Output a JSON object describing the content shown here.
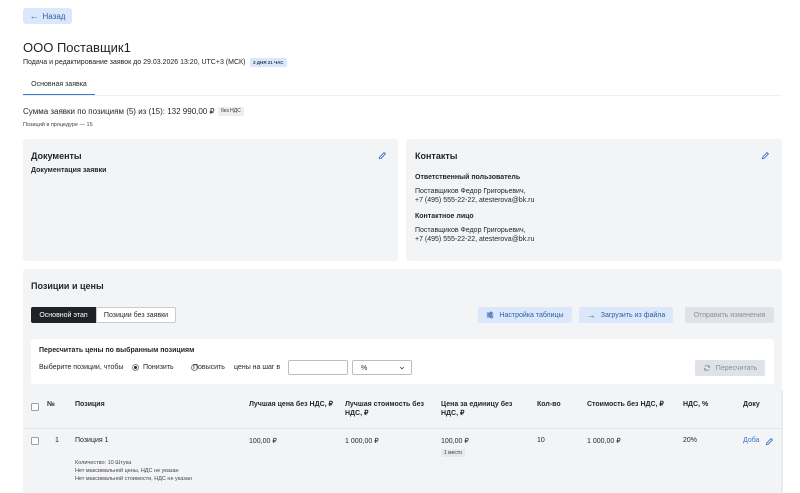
{
  "header": {
    "back_label": "Назад",
    "title": "ООО Поставщик1",
    "subtitle": "Подача и редактирование заявок до 29.03.2026 13:20, UTC+3 (МСК)",
    "deadline_badge": "3 ДНЯ 21 ЧАС"
  },
  "tabs": [
    {
      "label": "Основная заявка",
      "active": true
    }
  ],
  "summary": {
    "sum_text": "Сумма заявки по позициям (5) из (15): 132 990,00 ₽",
    "vat_badge": "без НДС",
    "positions_in_procedure": "Позиций в процедуре — 15"
  },
  "documents": {
    "title": "Документы",
    "subtitle": "Документация заявки"
  },
  "contacts": {
    "title": "Контакты",
    "responsible_label": "Ответственный пользователь",
    "responsible_name": "Поставщиков Федор Григорьевич,",
    "responsible_contact": "+7 (495) 555-22-22, atesterova@bk.ru",
    "contact_label": "Контактное лицо",
    "contact_name": "Поставщиков Федор Григорьевич,",
    "contact_contact": "+7 (495) 555-22-22, atesterova@bk.ru"
  },
  "positions": {
    "title": "Позиции и цены",
    "stage_tabs": [
      "Основной этап",
      "Позиции без заявки"
    ],
    "table_settings_label": "Настройка таблицы",
    "upload_label": "Загрузить из файла",
    "send_changes_label": "Отправить изменения",
    "recalc": {
      "title": "Пересчитать цены по выбранным позициям",
      "select_label": "Выберите позиции, чтобы",
      "decrease_label": "Понизить",
      "increase_label": "Повысить",
      "step_label": "цены на шаг в",
      "step_value": "",
      "unit_value": "%",
      "recalc_button": "Пересчитать"
    },
    "columns": {
      "num": "№",
      "position": "Позиция",
      "best_price": "Лучшая цена без НДС, ₽",
      "best_cost": "Лучшая стоимость без НДС, ₽",
      "unit_price": "Цена за единицу без НДС, ₽",
      "qty": "Кол-во",
      "cost": "Стоимость без НДС, ₽",
      "vat": "НДС, %",
      "docs": "Доку"
    },
    "rows": [
      {
        "num": "1",
        "name": "Позиция 1",
        "best_price": "100,00 ₽",
        "best_cost": "1 000,00 ₽",
        "unit_price": "100,00 ₽",
        "place": "1 место",
        "qty": "10",
        "cost": "1 000,00 ₽",
        "vat": "20%",
        "docs_link": "Доба",
        "note_qty": "Количество: 10 Штука",
        "note_max_price": "Нет максимальной цены, НДС не указан",
        "note_max_cost": "Нет максимальной стоимости, НДС не указан"
      }
    ]
  }
}
